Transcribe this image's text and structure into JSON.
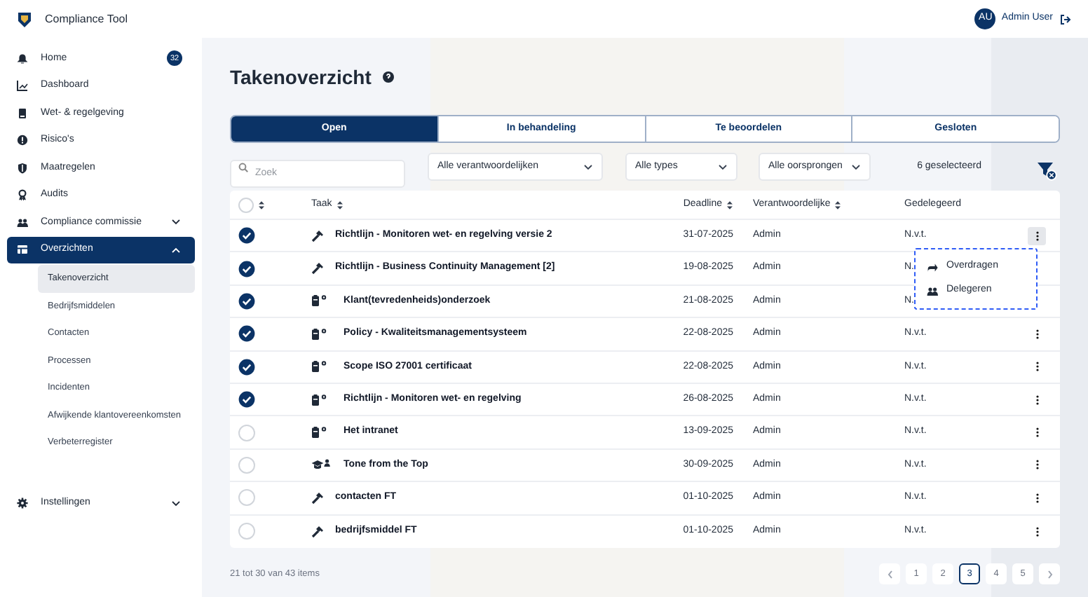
{
  "app": {
    "name": "Compliance Tool"
  },
  "user": {
    "initials": "AU",
    "name": "Admin User"
  },
  "sidebar": {
    "items": [
      {
        "label": "Home",
        "badge": "32",
        "selected": false
      },
      {
        "label": "Dashboard",
        "selected": false
      },
      {
        "label": "Wet- & regelgeving",
        "selected": false
      },
      {
        "label": "Risico's",
        "selected": false
      },
      {
        "label": "Maatregelen",
        "selected": false
      },
      {
        "label": "Audits",
        "selected": false
      },
      {
        "label": "Compliance commissie",
        "expanded": false,
        "selected": false
      },
      {
        "label": "Overzichten",
        "expanded": true,
        "selected": true,
        "children": [
          {
            "label": "Takenoverzicht",
            "selected": true
          },
          {
            "label": "Bedrijfsmiddelen",
            "selected": false
          },
          {
            "label": "Contacten",
            "selected": false
          },
          {
            "label": "Processen",
            "selected": false
          },
          {
            "label": "Incidenten",
            "selected": false
          },
          {
            "label": "Afwijkende klantovereenkomsten",
            "selected": false
          },
          {
            "label": "Verbeterregister",
            "selected": false
          }
        ]
      }
    ],
    "footer": {
      "label": "Instellingen",
      "expanded": false
    }
  },
  "page": {
    "title": "Takenoverzicht"
  },
  "tabs": [
    {
      "label": "Open",
      "selected": true
    },
    {
      "label": "In behandeling",
      "selected": false
    },
    {
      "label": "Te beoordelen",
      "selected": false
    },
    {
      "label": "Gesloten",
      "selected": false
    }
  ],
  "filters": {
    "search": {
      "placeholder": "Zoek"
    },
    "dropdowns": [
      "Alle verantwoordelijken",
      "Alle types",
      "Alle oorsprongen"
    ],
    "selection_count": "6 geselecteerd"
  },
  "table": {
    "all_selected": false,
    "columns": [
      "Taak",
      "Deadline",
      "Verantwoordelijke",
      "Gedelegeerd"
    ],
    "rows": [
      {
        "checked": true,
        "kind": "hammer",
        "task": "Richtlijn - Monitoren wet- en regelving versie  2",
        "deadline": "31-07-2025",
        "owner": "Admin",
        "delegated": "N.v.t.",
        "menu_open": true
      },
      {
        "checked": true,
        "kind": "hammer",
        "task": "Richtlijn - Business Continuity Management [2]",
        "deadline": "19-08-2025",
        "owner": "Admin",
        "delegated": "N.",
        "menu_open": false
      },
      {
        "checked": true,
        "kind": "document",
        "task": "Klant(tevredenheids)onderzoek",
        "deadline": "21-08-2025",
        "owner": "Admin",
        "delegated": "N.",
        "menu_open": false
      },
      {
        "checked": true,
        "kind": "document",
        "task": "Policy - Kwaliteitsmanagementsysteem",
        "deadline": "22-08-2025",
        "owner": "Admin",
        "delegated": "N.v.t.",
        "menu_open": false
      },
      {
        "checked": true,
        "kind": "document",
        "task": "Scope ISO 27001 certificaat",
        "deadline": "22-08-2025",
        "owner": "Admin",
        "delegated": "N.v.t.",
        "menu_open": false
      },
      {
        "checked": true,
        "kind": "document",
        "task": "Richtlijn - Monitoren wet- en regelving",
        "deadline": "26-08-2025",
        "owner": "Admin",
        "delegated": "N.v.t.",
        "menu_open": false
      },
      {
        "checked": false,
        "kind": "document",
        "task": "Het intranet",
        "deadline": "13-09-2025",
        "owner": "Admin",
        "delegated": "N.v.t.",
        "menu_open": false
      },
      {
        "checked": false,
        "kind": "course",
        "task": "Tone from the Top",
        "deadline": "30-09-2025",
        "owner": "Admin",
        "delegated": "N.v.t.",
        "menu_open": false
      },
      {
        "checked": false,
        "kind": "hammer",
        "task": "contacten FT",
        "deadline": "01-10-2025",
        "owner": "Admin",
        "delegated": "N.v.t.",
        "menu_open": false
      },
      {
        "checked": false,
        "kind": "hammer",
        "task": "bedrijfsmiddel FT",
        "deadline": "01-10-2025",
        "owner": "Admin",
        "delegated": "N.v.t.",
        "menu_open": false
      }
    ],
    "row_menu": [
      "Overdragen",
      "Delegeren"
    ]
  },
  "pagination": {
    "summary": "21 tot 30 van 43 items",
    "pages": [
      {
        "label": "1",
        "selected": false
      },
      {
        "label": "2",
        "selected": false
      },
      {
        "label": "3",
        "selected": true
      },
      {
        "label": "4",
        "selected": false
      },
      {
        "label": "5",
        "selected": false
      }
    ]
  }
}
